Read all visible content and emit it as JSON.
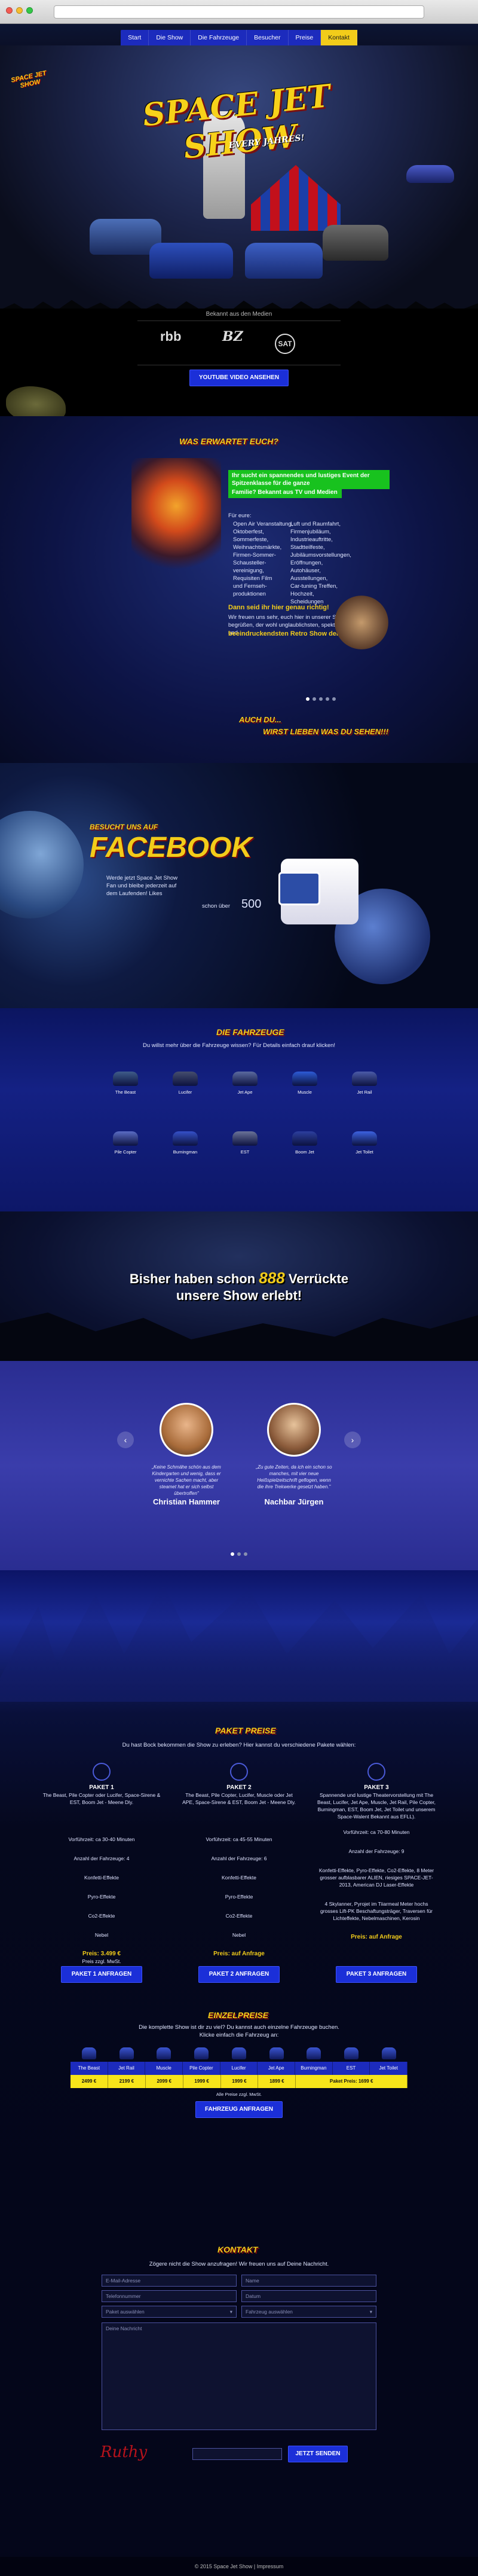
{
  "nav": {
    "items": [
      "Start",
      "Die Show",
      "Die Fahrzeuge",
      "Besucher",
      "Preise",
      "Kontakt"
    ],
    "active": 5
  },
  "hero": {
    "logo_small": "SPACE JET SHOW",
    "title": "SPACE JET SHOW",
    "subtitle": "EVERY JAHRES!"
  },
  "media": {
    "label": "Bekannt aus den Medien",
    "logos": [
      "rbb",
      "BZ",
      "SAT"
    ],
    "button": "YOUTUBE VIDEO ANSEHEN"
  },
  "about": {
    "title": "WAS ERWARTET EUCH?",
    "highlight1": "Ihr sucht ein spannendes und lustiges Event der Spitzenklasse für die ganze",
    "highlight2": "Familie? Bekannt aus TV und Medien",
    "for_label": "Für eure:",
    "left_list": [
      "Open Air Veranstaltung,",
      "Oktoberfest,",
      "Sommerfeste,",
      "Weihnachtsmärkte,",
      "Firmen-Sommer-",
      "Schausteller-",
      "vereinigung,",
      "Requisiten Film",
      "und Fernseh-",
      "produktionen"
    ],
    "right_list": [
      "Luft und Raumfahrt,",
      "Firmenjubiläum,",
      "Industrieauftritte,",
      "Stadtteilfeste,",
      "Jubiläumsvorstellungen,",
      "Eröffnungen,",
      "Autohäuser,",
      "Ausstellungen,",
      "Car-tuning Treffen,",
      "Hochzeit,",
      "Scheidungen"
    ],
    "yellow_text": "Dann seid ihr hier genau richtig!",
    "bottom_text": "Wir freuen uns sehr, euch hier in unserer Show begrüßen, der wohl unglaublichsten, spektakulärsten und",
    "bottom_yellow": "beeindruckendsten Retro Show der Galaxy",
    "cta_title": "AUCH DU...",
    "cta_sub": "WIRST LIEBEN WAS DU SEHEN!!!"
  },
  "facebook": {
    "kicker": "BESUCHT UNS AUF",
    "title": "FACEBOOK",
    "text": "Werde jetzt Space Jet Show Fan und bleibe jederzeit auf dem Laufenden! Likes",
    "likes_label": "schon über",
    "likes": "500"
  },
  "fleet": {
    "title": "DIE FAHRZEUGE",
    "subtitle": "Du willst mehr über die Fahrzeuge wissen? Für Details einfach drauf klicken!",
    "vehicles": [
      "The Beast",
      "Lucifer",
      "Jet Ape",
      "Muscle",
      "Jet Rail",
      "Pile Copter",
      "Burningman",
      "EST",
      "Boom Jet",
      "Jet Toilet"
    ],
    "colors": [
      "#3f5c8a",
      "#454d6e",
      "#5b6aa0",
      "#2d5ad6",
      "#4b5aa8",
      "#5a6cc4",
      "#3550c8",
      "#6a7298",
      "#2c3f9e",
      "#3c62e0"
    ]
  },
  "count": {
    "pre": "Bisher haben schon",
    "number": "888",
    "post": "Verrückte",
    "line2": "unsere Show erlebt!"
  },
  "testimonials": [
    {
      "quote": "„Keine Schmähe schön aus dem Kindergarten und wenig, dass er vernichte Sachen macht, aber steamet hat er sich selbst übertroffen\"",
      "name": "Christian Hammer"
    },
    {
      "quote": "„Zu gute Zeiten, da ich ein schon so manches, mit vier neue Heißspielzeitschrift geflogen, wenn die ihre Trekwerke gesetzt haben.\"",
      "name": "Nachbar Jürgen"
    }
  ],
  "pricing": {
    "title": "PAKET PREISE",
    "subtitle": "Du hast Bock bekommen die Show zu erleben? Hier kannst du verschiedene Pakete wählen:",
    "packages": [
      {
        "name": "PAKET 1",
        "desc": "The Beast, Pile Copter oder Lucifer, Space-Sirene & EST, Boom Jet - Meene Dly.",
        "stay": "Vorführzeit: ca 30-40 Minuten",
        "count": "Anzahl der Fahrzeuge: 4",
        "effects": "Konfetti-Effekte",
        "pyro": "Pyro-Effekte",
        "co2": "Co2-Effekte",
        "smoke": "Nebel",
        "price": "Preis: 3.499 €",
        "price_note": "Preis zzgl. MwSt.",
        "button": "PAKET 1 ANFRAGEN"
      },
      {
        "name": "PAKET 2",
        "desc": "The Beast, Pile Copter, Lucifer, Muscle oder Jet APE, Space-Sirene & EST, Boom Jet - Meene Dly.",
        "stay": "Vorführzeit: ca 45-55 Minuten",
        "count": "Anzahl der Fahrzeuge: 6",
        "effects": "Konfetti-Effekte",
        "pyro": "Pyro-Effekte",
        "co2": "Co2-Effekte",
        "smoke": "Nebel",
        "price": "Preis: auf Anfrage",
        "price_note": "",
        "button": "PAKET 2 ANFRAGEN"
      },
      {
        "name": "PAKET 3",
        "desc": "Spannende und lustige Theatervorstellung mit The Beast, Lucifer, Jet Ape, Muscle, Jet Rail, Pile Copter, Burningman, EST, Boom Jet, Jet Toilet und unserem Space-Walent Bekannt aus EFLL).",
        "stay": "Vorführzeit: ca 70-80 Minuten",
        "count": "Anzahl der Fahrzeuge: 9",
        "effects": "Konfetti-Effekte, Pyro-Effekte, Co2-Effekte, 8 Meter grosser aufblasbarer ALIEN, riesiges SPACE-JET-2013, American DJ Laser-Effekte",
        "pyro": "4 Skylanner, Pyrojet im Tiiarmeal Meter hochs grosses Lift-PK Beschaftungsträger, Traversen für Lichteffekte, Nebelmaschinen, Kerosin",
        "co2": "",
        "smoke": "",
        "price": "Preis: auf Anfrage",
        "price_note": "",
        "button": "PAKET 3 ANFRAGEN"
      }
    ]
  },
  "single": {
    "title": "EINZELPREISE",
    "subtitle": "Die komplette Show ist dir zu viel? Du kannst auch einzelne Fahrzeuge buchen. Klicke einfach die Fahrzeug an:",
    "names": [
      "The Beast",
      "Jet Rail",
      "Muscle",
      "Pile Copter",
      "Lucifer",
      "Jet Ape",
      "Burningman",
      "EST",
      "Jet Toilet"
    ],
    "prices": [
      "2499 €",
      "2199 €",
      "2099 €",
      "1999 €",
      "1999 €",
      "1899 €",
      "Paket Preis: 1699 €"
    ],
    "note": "Alle Preise zzgl. MwSt.",
    "button": "FAHRZEUG ANFRAGEN"
  },
  "contact": {
    "title": "KONTAKT",
    "subtitle": "Zögere nicht die Show anzufragen! Wir freuen uns auf Deine Nachricht.",
    "email_ph": "E-Mail-Adresse",
    "name_ph": "Name",
    "phone_ph": "Telefonnummer",
    "date_ph": "Datum",
    "package_ph": "Paket auswählen",
    "vehicle_ph": "Fahrzeug auswählen",
    "message_ph": "Deine Nachricht",
    "send": "JETZT SENDEN",
    "signature": "Ruthy"
  },
  "footer": {
    "text": "© 2015 Space Jet Show | Impressum"
  }
}
